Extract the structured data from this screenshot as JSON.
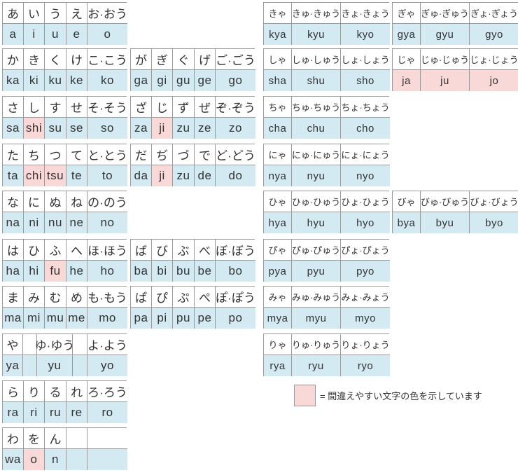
{
  "colors": {
    "romaji_bg": "#d3eaf2",
    "confusable_bg": "#f9d9d7",
    "border": "#9a9a9a"
  },
  "groups": [
    {
      "id": "a",
      "kana": [
        "あ",
        "い",
        "う",
        "え",
        "お·おう"
      ],
      "romaji": [
        "a",
        "i",
        "u",
        "e",
        "o"
      ],
      "pink": []
    },
    {
      "id": "ka",
      "kana": [
        "か",
        "き",
        "く",
        "け",
        "こ·こう"
      ],
      "romaji": [
        "ka",
        "ki",
        "ku",
        "ke",
        "ko"
      ],
      "pink": []
    },
    {
      "id": "sa",
      "kana": [
        "さ",
        "し",
        "す",
        "せ",
        "そ·そう"
      ],
      "romaji": [
        "sa",
        "shi",
        "su",
        "se",
        "so"
      ],
      "pink": [
        1
      ]
    },
    {
      "id": "ta",
      "kana": [
        "た",
        "ち",
        "つ",
        "て",
        "と·とう"
      ],
      "romaji": [
        "ta",
        "chi",
        "tsu",
        "te",
        "to"
      ],
      "pink": [
        1,
        2
      ]
    },
    {
      "id": "na",
      "kana": [
        "な",
        "に",
        "ぬ",
        "ね",
        "の·のう"
      ],
      "romaji": [
        "na",
        "ni",
        "nu",
        "ne",
        "no"
      ],
      "pink": []
    },
    {
      "id": "ha",
      "kana": [
        "は",
        "ひ",
        "ふ",
        "へ",
        "ほ·ほう"
      ],
      "romaji": [
        "ha",
        "hi",
        "fu",
        "he",
        "ho"
      ],
      "pink": [
        2
      ]
    },
    {
      "id": "ma",
      "kana": [
        "ま",
        "み",
        "む",
        "め",
        "も·もう"
      ],
      "romaji": [
        "ma",
        "mi",
        "mu",
        "me",
        "mo"
      ],
      "pink": []
    },
    {
      "id": "ya",
      "kana": [
        "や",
        "",
        "ゆ·ゆう",
        "",
        "よ·よう"
      ],
      "romaji": [
        "ya",
        "",
        "yu",
        "",
        "yo"
      ],
      "pink": []
    },
    {
      "id": "ra",
      "kana": [
        "ら",
        "り",
        "る",
        "れ",
        "ろ·ろう"
      ],
      "romaji": [
        "ra",
        "ri",
        "ru",
        "re",
        "ro"
      ],
      "pink": []
    },
    {
      "id": "wa",
      "kana": [
        "わ",
        "を",
        "ん",
        "",
        ""
      ],
      "romaji": [
        "wa",
        "o",
        "n",
        "",
        ""
      ],
      "pink": [
        1
      ]
    },
    {
      "id": "ga",
      "kana": [
        "が",
        "ぎ",
        "ぐ",
        "げ",
        "ご·ごう"
      ],
      "romaji": [
        "ga",
        "gi",
        "gu",
        "ge",
        "go"
      ],
      "pink": []
    },
    {
      "id": "za",
      "kana": [
        "ざ",
        "じ",
        "ず",
        "ぜ",
        "ぞ·ぞう"
      ],
      "romaji": [
        "za",
        "ji",
        "zu",
        "ze",
        "zo"
      ],
      "pink": [
        1
      ]
    },
    {
      "id": "da",
      "kana": [
        "だ",
        "ぢ",
        "づ",
        "で",
        "ど·どう"
      ],
      "romaji": [
        "da",
        "ji",
        "zu",
        "de",
        "do"
      ],
      "pink": [
        1
      ]
    },
    {
      "id": "ba",
      "kana": [
        "ば",
        "び",
        "ぶ",
        "べ",
        "ぼ·ぼう"
      ],
      "romaji": [
        "ba",
        "bi",
        "bu",
        "be",
        "bo"
      ],
      "pink": []
    },
    {
      "id": "pa",
      "kana": [
        "ぱ",
        "ぴ",
        "ぷ",
        "ぺ",
        "ぽ·ぽう"
      ],
      "romaji": [
        "pa",
        "pi",
        "pu",
        "pe",
        "po"
      ],
      "pink": []
    },
    {
      "id": "kya",
      "kana": [
        "きゃ",
        "きゅ·きゅう",
        "きょ·きょう"
      ],
      "romaji": [
        "kya",
        "kyu",
        "kyo"
      ],
      "pink": []
    },
    {
      "id": "sha",
      "kana": [
        "しゃ",
        "しゅ·しゅう",
        "しょ·しょう"
      ],
      "romaji": [
        "sha",
        "shu",
        "sho"
      ],
      "pink": []
    },
    {
      "id": "cha",
      "kana": [
        "ちゃ",
        "ちゅ·ちゅう",
        "ちょ·ちょう"
      ],
      "romaji": [
        "cha",
        "chu",
        "cho"
      ],
      "pink": []
    },
    {
      "id": "nya",
      "kana": [
        "にゃ",
        "にゅ·にゅう",
        "にょ·にょう"
      ],
      "romaji": [
        "nya",
        "nyu",
        "nyo"
      ],
      "pink": []
    },
    {
      "id": "hya",
      "kana": [
        "ひゃ",
        "ひゅ·ひゅう",
        "ひょ·ひょう"
      ],
      "romaji": [
        "hya",
        "hyu",
        "hyo"
      ],
      "pink": []
    },
    {
      "id": "pya",
      "kana": [
        "ぴゃ",
        "ぴゅ·ぴゅう",
        "ぴょ·ぴょう"
      ],
      "romaji": [
        "pya",
        "pyu",
        "pyo"
      ],
      "pink": []
    },
    {
      "id": "mya",
      "kana": [
        "みゃ",
        "みゅ·みゅう",
        "みょ·みょう"
      ],
      "romaji": [
        "mya",
        "myu",
        "myo"
      ],
      "pink": []
    },
    {
      "id": "rya",
      "kana": [
        "りゃ",
        "りゅ·りゅう",
        "りょ·りょう"
      ],
      "romaji": [
        "rya",
        "ryu",
        "ryo"
      ],
      "pink": []
    },
    {
      "id": "gya",
      "kana": [
        "ぎゃ",
        "ぎゅ·ぎゅう",
        "ぎょ·ぎょう"
      ],
      "romaji": [
        "gya",
        "gyu",
        "gyo"
      ],
      "pink": []
    },
    {
      "id": "ja",
      "kana": [
        "じゃ",
        "じゅ·じゅう",
        "じょ·じょう"
      ],
      "romaji": [
        "ja",
        "ju",
        "jo"
      ],
      "pink": [
        0,
        1,
        2
      ]
    },
    {
      "id": "bya",
      "kana": [
        "びゃ",
        "びゅ·びゅう",
        "びょ·びょう"
      ],
      "romaji": [
        "bya",
        "byu",
        "byo"
      ],
      "pink": []
    }
  ],
  "legend": {
    "text": "= 間違えやすい文字の色を示しています"
  }
}
